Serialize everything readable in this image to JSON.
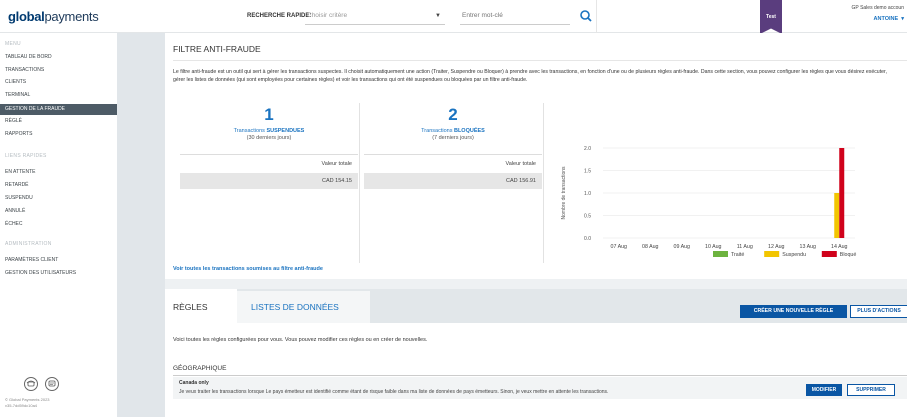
{
  "header": {
    "logo_bold": "global",
    "logo_rest": "payments",
    "quick_search_label": "RECHERCHE RAPIDE:",
    "criteria_placeholder": "Choisir critère",
    "keyword_placeholder": "Entrer mot-clé",
    "env_badge": "Test",
    "account_name": "GP Sales demo accoun",
    "user_name": "ANTOINE"
  },
  "sidebar": {
    "menu_heading": "MENU",
    "menu_items": [
      "TABLEAU DE BORD",
      "TRANSACTIONS",
      "CLIENTS",
      "TERMINAL",
      "GESTION DE LA FRAUDE",
      "RÈGLÉ",
      "RAPPORTS"
    ],
    "active_item": "GESTION DE LA FRAUDE",
    "quick_links_heading": "LIENS RAPIDES",
    "quick_links": [
      "EN ATTENTE",
      "RETARDÉ",
      "SUSPENDU",
      "ANNULÉ",
      "ÉCHEC"
    ],
    "admin_heading": "ADMINISTRATION",
    "admin_items": [
      "PARAMÈTRES CLIENT",
      "GESTION DES UTILISATEURS"
    ],
    "copyright": "© Global Payments 2023",
    "version": "v35-7dd59dc10a4"
  },
  "fraud": {
    "title": "FILTRE ANTI-FRAUDE",
    "description": "Le filtre anti-fraude est un outil qui sert à gérer les transactions suspectes. Il choisit automatiquement une action (Traiter, Suspendre ou Bloquer) à prendre avec les transactions, en fonction d'une ou de plusieurs règles anti-fraude. Dans cette section, vous pouvez configurer les règles que vous désirez exécuter, gérer les listes de données (qui sont employées pour certaines règles) et voir les transactions qui ont été suspendues ou bloquées par un filtre anti-fraude.",
    "suspended": {
      "count": "1",
      "label_prefix": "Transactions ",
      "label_bold": "SUSPENDUES",
      "period": "(30 derniers jours)",
      "total_label": "Valeur totale",
      "total_value": "CAD 154.15"
    },
    "blocked": {
      "count": "2",
      "label_prefix": "Transactions ",
      "label_bold": "BLOQUÉES",
      "period": "(7 derniers jours)",
      "total_label": "Valeur totale",
      "total_value": "CAD 156.91"
    },
    "link": "Voir toutes les transactions soumises au filtre anti-fraude"
  },
  "chart_data": {
    "type": "bar",
    "stacked": true,
    "categories": [
      "07 Aug",
      "08 Aug",
      "09 Aug",
      "10 Aug",
      "11 Aug",
      "12 Aug",
      "13 Aug",
      "14 Aug"
    ],
    "series": [
      {
        "name": "Traité",
        "color": "#6db33f",
        "values": [
          0,
          0,
          0,
          0,
          0,
          0,
          0,
          0
        ]
      },
      {
        "name": "Suspendu",
        "color": "#f2c500",
        "values": [
          0,
          0,
          0,
          0,
          0,
          0,
          0,
          1
        ]
      },
      {
        "name": "Bloqué",
        "color": "#d0021b",
        "values": [
          0,
          0,
          0,
          0,
          0,
          0,
          0,
          2
        ]
      }
    ],
    "ylabel": "Nombre de transactions",
    "yticks": [
      "0.0",
      "0.5",
      "1.0",
      "1.5",
      "2.0"
    ],
    "ylim": [
      0,
      2
    ],
    "grid": true,
    "legend": "bottom-right"
  },
  "rules_panel": {
    "tab_rules": "RÈGLES",
    "tab_lists": "LISTES DE DONNÉES",
    "create_button": "CRÉER UNE NOUVELLE RÈGLE",
    "more_button": "PLUS D'ACTIONS",
    "description": "Voici toutes les règles configurées pour vous. Vous pouvez modifier ces règles ou en créer de nouvelles.",
    "section_title": "GÉOGRAPHIQUE",
    "rule": {
      "name": "Canada only",
      "text": "Je veux traiter les transactions lorsque Le pays émetteur est identifié comme étant de risque faible dans ma liste de données de pays émetteurs. Sinon, je veux mettre en attente les transactions.",
      "modify_button": "MODIFIER",
      "delete_button": "SUPPRIMER"
    }
  },
  "colors": {
    "accent": "#1a73c0",
    "button": "#0a56a4",
    "badge": "#5a3d7e",
    "sidebar_active": "#4d5b66"
  }
}
